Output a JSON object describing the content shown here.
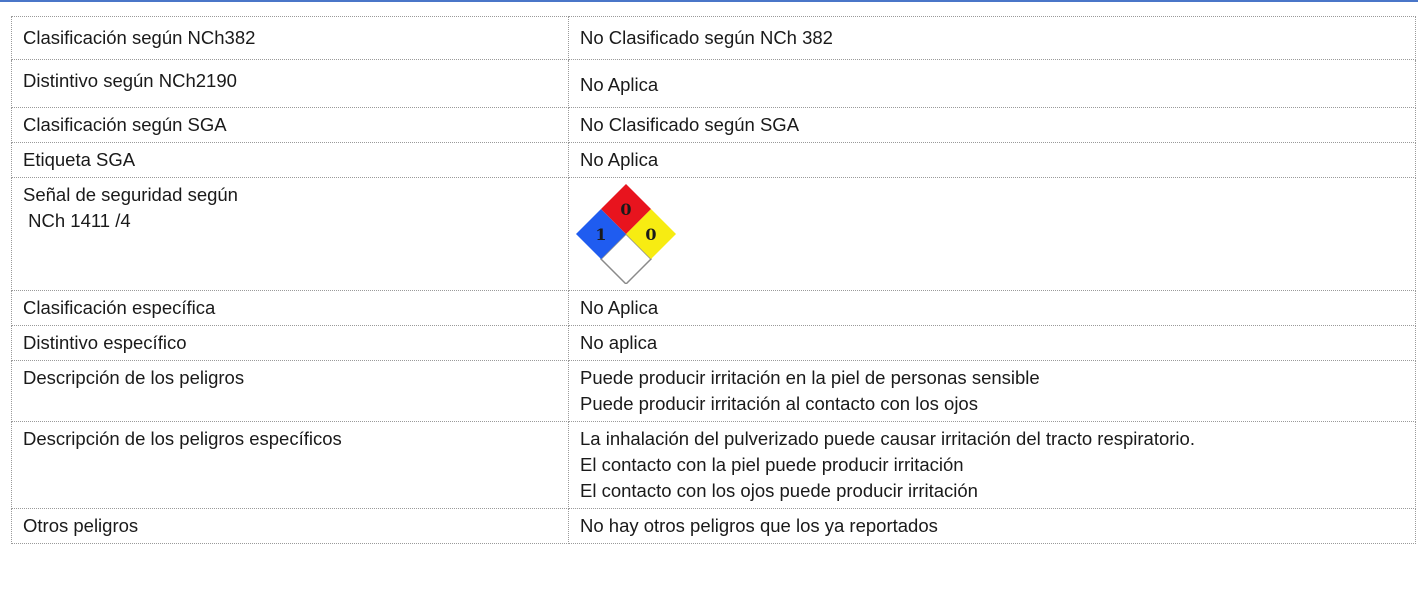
{
  "table": {
    "rows": [
      {
        "label": [
          "Clasificación según NCh382"
        ],
        "value": [
          "No Clasificado según NCh 382"
        ]
      },
      {
        "label": [
          "Distintivo según NCh2190"
        ],
        "value": [
          "No Aplica"
        ]
      },
      {
        "label": [
          "Clasificación según SGA"
        ],
        "value": [
          "No Clasificado según SGA"
        ]
      },
      {
        "label": [
          "Etiqueta SGA"
        ],
        "value": [
          "No Aplica"
        ]
      },
      {
        "label": [
          "Señal de seguridad según",
          " NCh 1411 /4"
        ],
        "value": []
      },
      {
        "label": [
          "Clasificación específica"
        ],
        "value": [
          "No Aplica"
        ]
      },
      {
        "label": [
          "Distintivo específico"
        ],
        "value": [
          "No aplica"
        ]
      },
      {
        "label": [
          "Descripción de los peligros"
        ],
        "value": [
          "Puede producir irritación en la piel de personas sensible",
          "Puede producir irritación al contacto con los ojos"
        ]
      },
      {
        "label": [
          "Descripción de los peligros específicos"
        ],
        "value": [
          "La inhalación del pulverizado puede causar irritación del tracto respiratorio.",
          "El contacto con la piel puede producir irritación",
          "El contacto con los ojos puede producir irritación"
        ]
      },
      {
        "label": [
          "Otros peligros"
        ],
        "value": [
          "No hay otros peligros que los ya reportados"
        ]
      }
    ]
  },
  "nfpa_diamond": {
    "health": "1",
    "flammability": "0",
    "instability": "0",
    "special": "",
    "colors": {
      "health": "#1f5cf0",
      "flammability": "#e8141e",
      "instability": "#f7ec12",
      "special": "#ffffff"
    }
  }
}
